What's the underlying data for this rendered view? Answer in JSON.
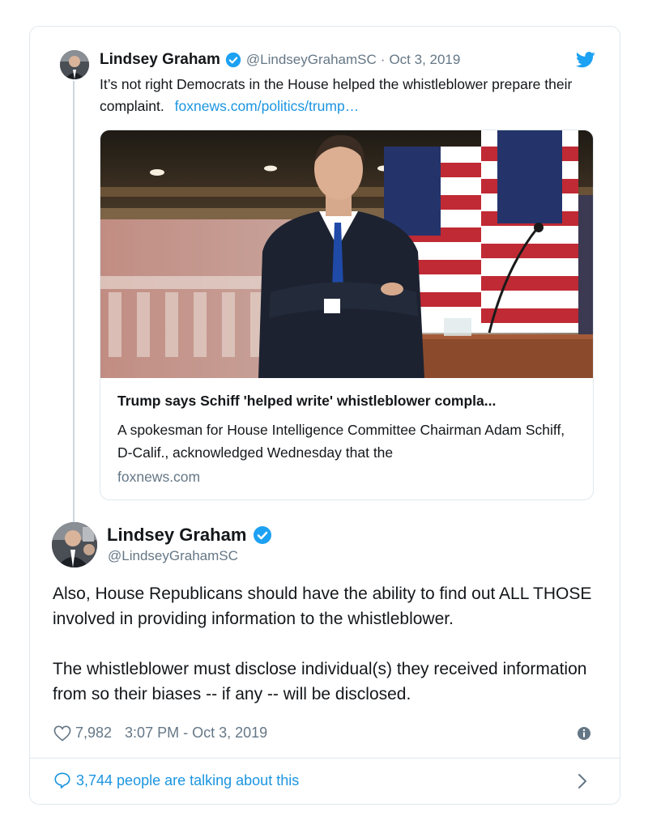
{
  "parent_tweet": {
    "name": "Lindsey Graham",
    "handle": "@LindseyGrahamSC",
    "separator": "·",
    "date": "Oct 3, 2019",
    "text": "It’s not right Democrats in the House helped the whistleblower prepare their complaint.",
    "link": "foxnews.com/politics/trump…"
  },
  "link_card": {
    "title": "Trump says Schiff 'helped write' whistleblower compla...",
    "description": "A spokesman for House Intelligence Committee Chairman Adam Schiff, D-Calif., acknowledged Wednesday that the",
    "domain": "foxnews.com"
  },
  "main_tweet": {
    "name": "Lindsey Graham",
    "handle": "@LindseyGrahamSC",
    "paragraphs": [
      "Also, House Republicans should have the ability to find out ALL THOSE involved in providing information to the whistleblower.",
      "The whistleblower must disclose individual(s) they received information from so their biases -- if any -- will be disclosed."
    ],
    "likes": "7,982",
    "timestamp": "3:07 PM - Oct 3, 2019",
    "talking": "3,744 people are talking about this"
  },
  "icons": {
    "verified": "verified-badge-icon",
    "bird": "twitter-bird-icon",
    "heart": "heart-icon",
    "info": "info-icon",
    "bubble": "speech-bubble-icon",
    "chevron": "chevron-right-icon"
  },
  "colors": {
    "link": "#1b95e0",
    "secondary_text": "#657786",
    "border": "#e1e8ed",
    "verified": "#1da1f2"
  }
}
